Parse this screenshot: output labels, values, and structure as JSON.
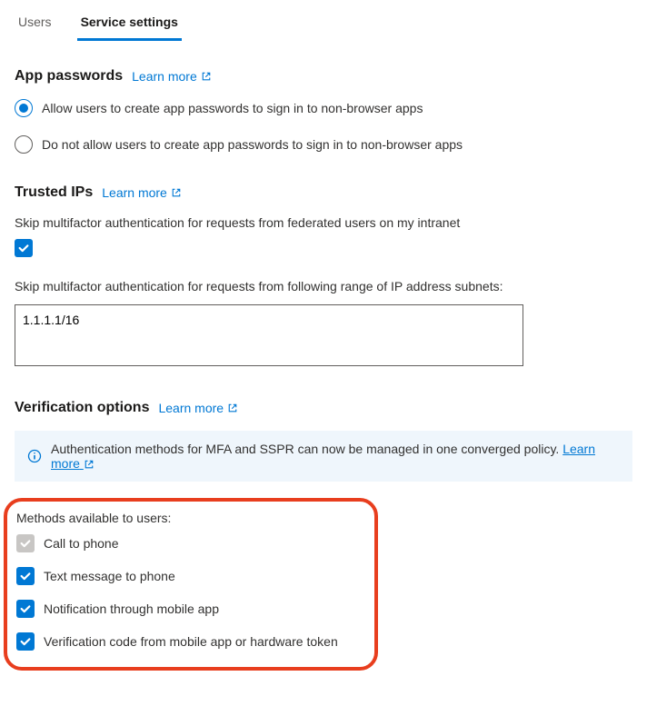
{
  "tabs": {
    "users": "Users",
    "service_settings": "Service settings"
  },
  "app_passwords": {
    "title": "App passwords",
    "learn_more": "Learn more",
    "opt_allow": "Allow users to create app passwords to sign in to non-browser apps",
    "opt_disallow": "Do not allow users to create app passwords to sign in to non-browser apps",
    "selected": "allow"
  },
  "trusted_ips": {
    "title": "Trusted IPs",
    "learn_more": "Learn more",
    "skip_federated_label": "Skip multifactor authentication for requests from federated users on my intranet",
    "skip_federated_checked": true,
    "ip_range_label": "Skip multifactor authentication for requests from following range of IP address subnets:",
    "ip_range_value": "1.1.1.1/16"
  },
  "verification": {
    "title": "Verification options",
    "learn_more": "Learn more",
    "banner_text": "Authentication methods for MFA and SSPR can now be managed in one converged policy. ",
    "banner_link": "Learn more",
    "methods_label": "Methods available to users:",
    "methods": [
      {
        "label": "Call to phone",
        "checked": true,
        "disabled": true
      },
      {
        "label": "Text message to phone",
        "checked": true,
        "disabled": false
      },
      {
        "label": "Notification through mobile app",
        "checked": true,
        "disabled": false
      },
      {
        "label": "Verification code from mobile app or hardware token",
        "checked": true,
        "disabled": false
      }
    ]
  }
}
